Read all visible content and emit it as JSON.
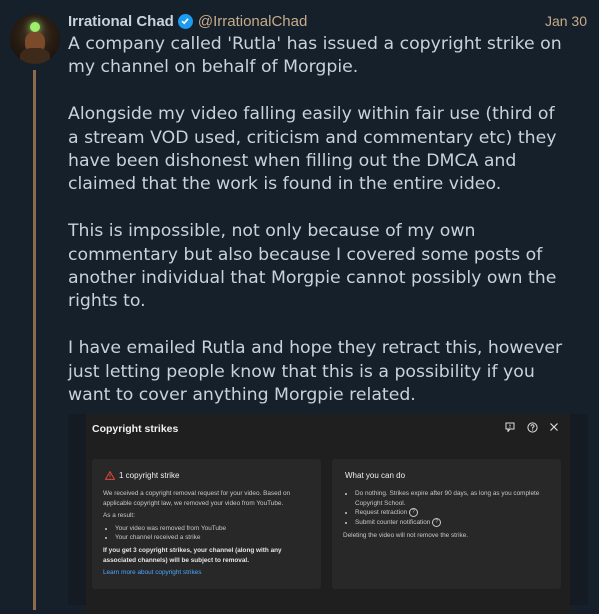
{
  "user": {
    "display_name": "Irrational Chad",
    "handle": "@IrrationalChad",
    "date": "Jan 30"
  },
  "tweet": {
    "paragraphs": [
      [
        "A company called 'Rutla' has issued a copyright strike on",
        "my channel on behalf of Morgpie."
      ],
      [
        "Alongside my video falling easily within fair use (third of",
        "a stream VOD used, criticism and commentary etc) they",
        "have been dishonest when filling out the DMCA and",
        "claimed that the work is found in the entire video."
      ],
      [
        "This is impossible, not only because of my own",
        "commentary but also because I covered some posts of",
        "another individual that Morgpie cannot possibly own the",
        "rights to."
      ],
      [
        "I have emailed Rutla and hope they retract this, however",
        "just letting people know that this is a possibility if you",
        "want to cover anything Morgpie related."
      ]
    ]
  },
  "card": {
    "title": "Copyright strikes",
    "icons": [
      "feedback-icon",
      "help-icon",
      "close-icon"
    ],
    "left": {
      "heading": "1 copyright strike",
      "intro": "We received a copyright removal request for your video. Based on applicable copyright law, we removed your video from YouTube.",
      "result_label": "As a result:",
      "results": [
        "Your video was removed from YouTube",
        "Your channel received a strike"
      ],
      "warning": "If you get 3 copyright strikes, your channel (along with any associated channels) will be subject to removal.",
      "link": "Learn more about copyright strikes"
    },
    "right": {
      "heading": "What you can do",
      "options": [
        "Do nothing. Strikes expire after 90 days, as long as you complete Copyright School.",
        "Request retraction",
        "Submit counter notification"
      ],
      "note": "Deleting the video will not remove the strike."
    }
  },
  "colors": {
    "background": "#15202b",
    "accent_handle": "#c8ab8a",
    "verified": "#1d9bf0",
    "link": "#4aa8ff",
    "warning": "#e0453a"
  }
}
